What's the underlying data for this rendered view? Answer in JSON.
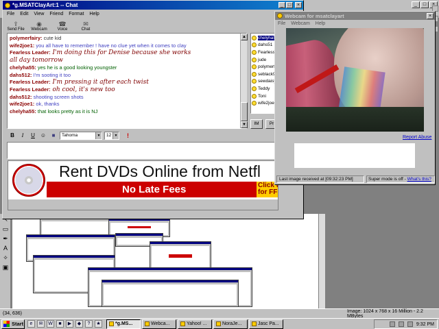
{
  "paint": {
    "status_coords": "(34, 636)",
    "status_image": "Image:  1024 x 768 x 16 Million - 2.2 MBytes",
    "tools": [
      "↖",
      "▭",
      "✒",
      "A",
      "✧",
      "▣"
    ]
  },
  "chat": {
    "title": "*g.MSATClayArt:1 -- Chat",
    "menu": [
      "File",
      "Edit",
      "View",
      "Friend",
      "Format",
      "Help"
    ],
    "toolbar": [
      {
        "label": "Send File",
        "icon": "⇪"
      },
      {
        "label": "Webcam",
        "icon": "◉"
      },
      {
        "label": "Voice",
        "icon": "☎"
      },
      {
        "label": "Chat",
        "icon": "✉"
      }
    ],
    "messages": [
      {
        "sender": "polymerfairy:",
        "text": " cute kid",
        "style": "text-plain"
      },
      {
        "sender": "wife2joe1:",
        "text": " you all have to remember ! have no clue yet when it comes to clay",
        "style": "text-blue"
      },
      {
        "sender": "Fearless Leader:",
        "text": " I'm doing this for Denise because she works",
        "style": "text-script"
      },
      {
        "sender": "",
        "text": "  all day tomorrow",
        "style": "text-script"
      },
      {
        "sender": "chelyha55:",
        "text": " yes he is a good looking youngster",
        "style": "text-green"
      },
      {
        "sender": "dahs512:",
        "text": " I'm sooting it too",
        "style": "text-blue"
      },
      {
        "sender": "Fearless Leader:",
        "text": " I'm pressing it after each twist",
        "style": "text-script"
      },
      {
        "sender": "Fearless Leader:",
        "text": " oh cool, it's new too",
        "style": "text-script"
      },
      {
        "sender": "dahs512:",
        "text": " shooting screen shots",
        "style": "text-blue"
      },
      {
        "sender": "wife2joe1:",
        "text": " ok, thanks",
        "style": "text-blue"
      },
      {
        "sender": "chelyha55:",
        "text": " that looks pretty as it is NJ",
        "style": "text-green"
      }
    ],
    "buddies": [
      "chelyha55",
      "dahs51",
      "Fearless",
      "jude",
      "polymerfa",
      "seblack9",
      "sewdaisy",
      "Teddy",
      "Toni",
      "wife2joe1"
    ],
    "buddy_selected": 0,
    "im_button": "IM",
    "profile_button": "Pr",
    "format": {
      "bold": "B",
      "italic": "I",
      "underline": "U",
      "emoticon": "☺",
      "font": "Tahoma",
      "size": "12",
      "alert": "!"
    },
    "input_value": ""
  },
  "ad": {
    "headline": "Rent DVDs Online from Netfl",
    "subline": "No Late Fees",
    "cta": "Click to t\nfor FF"
  },
  "webcam": {
    "title": "Webcam for msatclayart",
    "menu": [
      "File",
      "Webcam",
      "Help"
    ],
    "report_abuse": "Report Abuse",
    "status_left": "Last image received at [09:32:23 PM]",
    "status_right_prefix": "Super mode is off - ",
    "status_right_link": "What's this?"
  },
  "taskbar": {
    "start": "Start",
    "quicklaunch": [
      "e",
      "✉",
      "W",
      "■",
      "▶",
      "◆",
      "?",
      "★"
    ],
    "tasks": [
      {
        "label": "*g.MS...",
        "active": true
      },
      {
        "label": "Webca...",
        "active": false
      },
      {
        "label": "Yahoo! ...",
        "active": false
      },
      {
        "label": "NoraJe...",
        "active": false
      },
      {
        "label": "Jasc Pa...",
        "active": false
      }
    ],
    "clock": "9:32 PM"
  }
}
